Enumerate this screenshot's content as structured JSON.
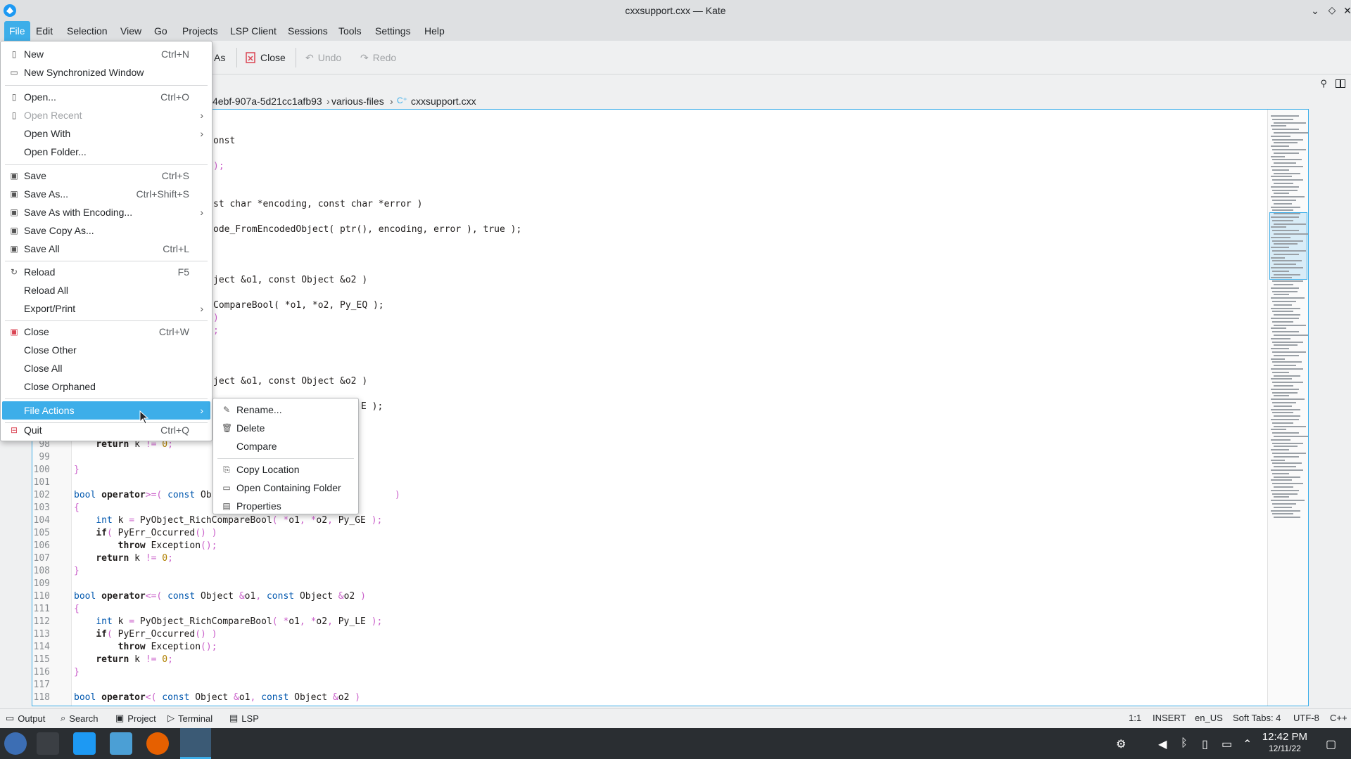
{
  "window": {
    "title": "cxxsupport.cxx — Kate"
  },
  "menubar": [
    "File",
    "Edit",
    "Selection",
    "View",
    "Go",
    "Projects",
    "LSP Client",
    "Sessions",
    "Tools",
    "Settings",
    "Help"
  ],
  "toolbar": {
    "save_as_partial": "As",
    "close": "Close",
    "undo": "Undo",
    "redo": "Redo"
  },
  "breadcrumb": {
    "folder_partial": "4ebf-907a-5d21cc1afb93",
    "folder": "various-files",
    "file": "cxxsupport.cxx"
  },
  "code": {
    "line_numbers": [
      "98",
      "99",
      "100",
      "101",
      "102",
      "103",
      "104",
      "105",
      "106",
      "107",
      "108",
      "109",
      "110",
      "111",
      "112",
      "113",
      "114",
      "115",
      "116",
      "117",
      "118"
    ],
    "partial_top": [
      "onst",
      ");",
      "st char *encoding, const char *error )",
      "ode_FromEncodedObject( ptr(), encoding, error ), true );",
      "ject &o1, const Object &o2 )",
      "CompareBool( *o1, *o2, Py_EQ );",
      ")",
      ";",
      "ject &o1, const Object &o2 )",
      "E );"
    ]
  },
  "file_menu": {
    "items": [
      {
        "label": "New",
        "shortcut": "Ctrl+N",
        "icon": "new-doc-icon"
      },
      {
        "label": "New Synchronized Window",
        "shortcut": "",
        "icon": "window-icon"
      },
      {
        "label": "Open...",
        "shortcut": "Ctrl+O",
        "icon": "open-icon"
      },
      {
        "label": "Open Recent",
        "shortcut": "",
        "icon": "recent-icon"
      },
      {
        "label": "Open With",
        "shortcut": "",
        "icon": ""
      },
      {
        "label": "Open Folder...",
        "shortcut": "",
        "icon": ""
      },
      {
        "label": "Save",
        "shortcut": "Ctrl+S",
        "icon": "save-icon"
      },
      {
        "label": "Save As...",
        "shortcut": "Ctrl+Shift+S",
        "icon": "save-as-icon"
      },
      {
        "label": "Save As with Encoding...",
        "shortcut": "",
        "icon": "save-as-icon"
      },
      {
        "label": "Save Copy As...",
        "shortcut": "",
        "icon": "save-copy-icon"
      },
      {
        "label": "Save All",
        "shortcut": "Ctrl+L",
        "icon": "save-all-icon"
      },
      {
        "label": "Reload",
        "shortcut": "F5",
        "icon": "reload-icon"
      },
      {
        "label": "Reload All",
        "shortcut": "",
        "icon": ""
      },
      {
        "label": "Export/Print",
        "shortcut": "",
        "icon": ""
      },
      {
        "label": "Close",
        "shortcut": "Ctrl+W",
        "icon": "close-doc-icon"
      },
      {
        "label": "Close Other",
        "shortcut": "",
        "icon": ""
      },
      {
        "label": "Close All",
        "shortcut": "",
        "icon": ""
      },
      {
        "label": "Close Orphaned",
        "shortcut": "",
        "icon": ""
      },
      {
        "label": "File Actions",
        "shortcut": "",
        "icon": ""
      },
      {
        "label": "Quit",
        "shortcut": "Ctrl+Q",
        "icon": "quit-icon"
      }
    ]
  },
  "file_actions_menu": {
    "items": [
      "Rename...",
      "Delete",
      "Compare",
      "Copy Location",
      "Open Containing Folder",
      "Properties"
    ]
  },
  "statusbar": {
    "tabs": [
      "Output",
      "Search",
      "Project",
      "Terminal",
      "LSP"
    ],
    "cursor": "1:1",
    "mode": "INSERT",
    "lang": "en_US",
    "indent": "Soft Tabs: 4",
    "encoding": "UTF-8",
    "filetype": "C++"
  },
  "taskbar": {
    "time": "12:42 PM",
    "date": "12/11/22"
  }
}
